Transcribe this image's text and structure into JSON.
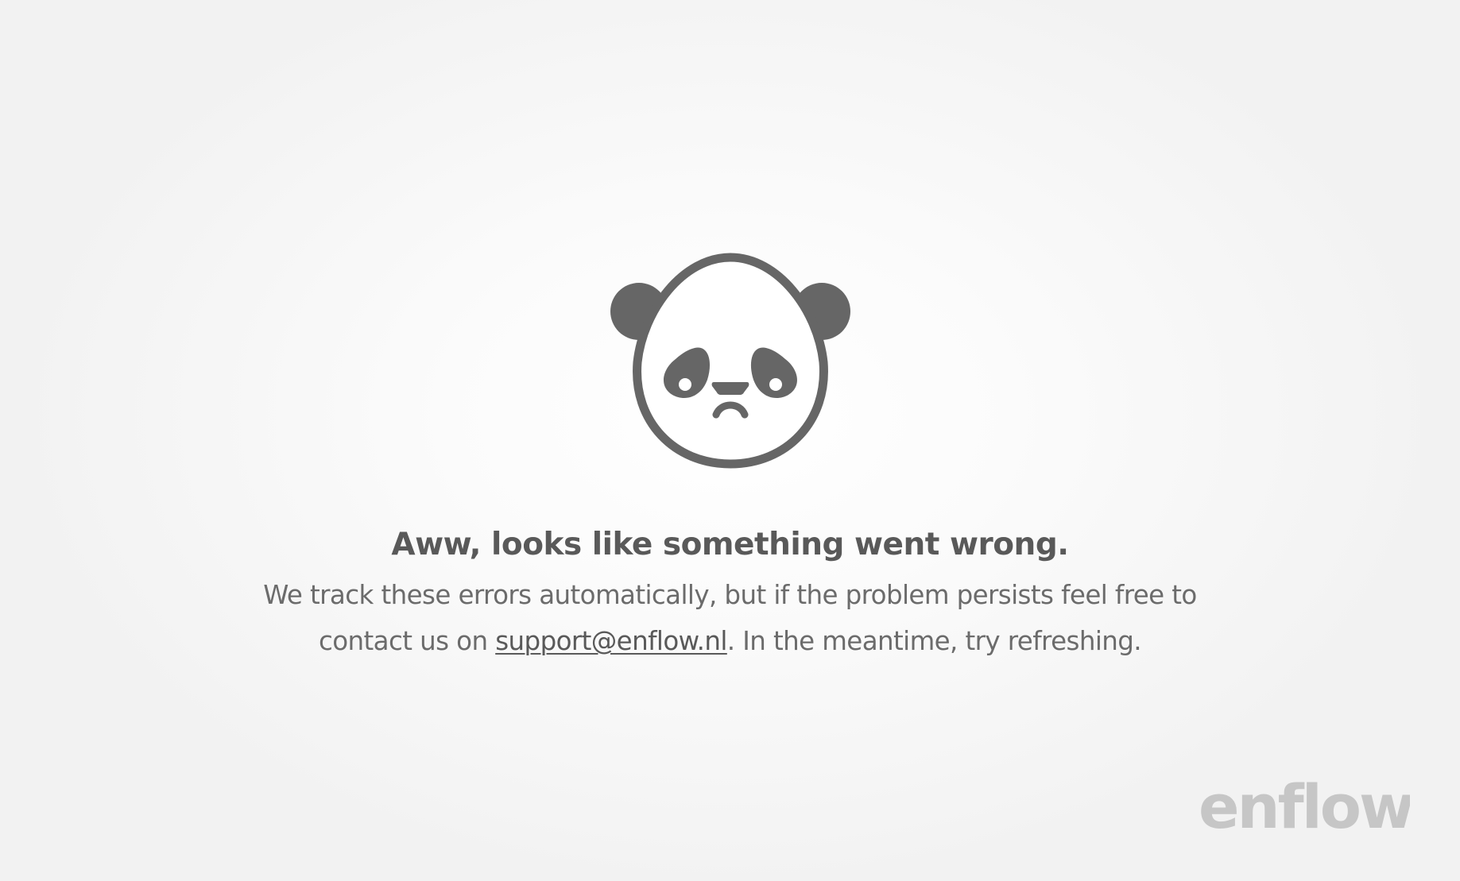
{
  "error": {
    "illustration": "sad-panda-icon",
    "heading": "Aww, looks like something went wrong.",
    "message_part1": "We track these errors automatically, but if the problem persists feel free to contact us on ",
    "support_email": "support@enflow.nl",
    "message_part2": ". In the meantime, try refreshing."
  },
  "brand": {
    "logo_text": "enflow"
  },
  "colors": {
    "icon": "#666666",
    "heading": "#595959",
    "body_text": "#6b6b6b",
    "logo": "#c6c6c6",
    "background": "#f5f5f5"
  }
}
